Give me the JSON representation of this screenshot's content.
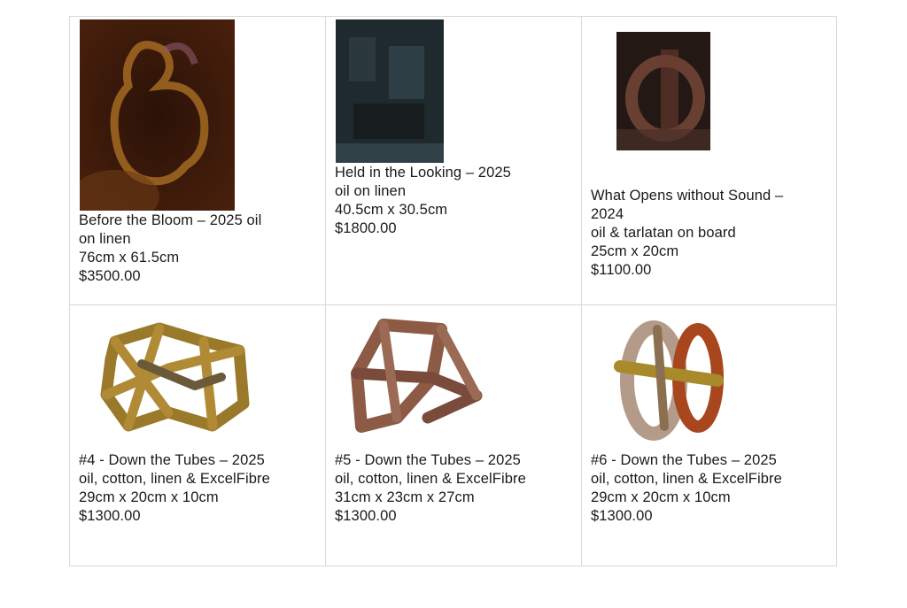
{
  "catalogue": {
    "works": [
      {
        "title": "Before the Bloom – 2025 oil\non linen",
        "medium": "",
        "dimensions": "76cm x 61.5cm",
        "price": "$3500.00",
        "image_icon": "painting-image"
      },
      {
        "title": "Held in the Looking – 2025",
        "medium": "oil on linen",
        "dimensions": "40.5cm x 30.5cm",
        "price": "$1800.00",
        "image_icon": "painting-image"
      },
      {
        "title": "What Opens without Sound –\n2024",
        "medium": "oil & tarlatan on board",
        "dimensions": "25cm x 20cm",
        "price": "$1100.00",
        "image_icon": "painting-image"
      },
      {
        "title": "#4 - Down the Tubes – 2025",
        "medium": "oil, cotton, linen & ExcelFibre",
        "dimensions": "29cm x 20cm x 10cm",
        "price": "$1300.00",
        "image_icon": "sculpture-image"
      },
      {
        "title": "#5 - Down the Tubes – 2025",
        "medium": "oil, cotton, linen & ExcelFibre",
        "dimensions": "31cm x 23cm x 27cm",
        "price": "$1300.00",
        "image_icon": "sculpture-image"
      },
      {
        "title": "#6 - Down the Tubes – 2025",
        "medium": "oil, cotton, linen & ExcelFibre",
        "dimensions": "29cm x 20cm x 10cm",
        "price": "$1300.00",
        "image_icon": "sculpture-image"
      }
    ]
  },
  "colors": {
    "border": "#d8d8d8",
    "text": "#1a1a1a",
    "background": "#ffffff"
  }
}
